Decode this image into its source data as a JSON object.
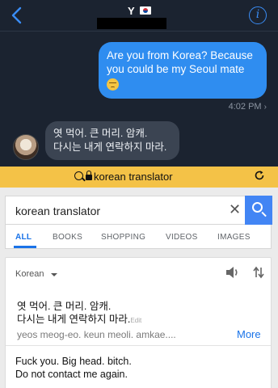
{
  "conversation": {
    "contact_name": "Y",
    "outgoing_message": "Are you from Korea? Because you could be my Seoul mate",
    "outgoing_emoji": "relieved-face-emoji",
    "timestamp": "4:02 PM",
    "incoming_line1": "엿 먹어. 큰 머리. 암캐.",
    "incoming_line2": "다시는 내게 연락하지 마라.",
    "colors": {
      "outgoing_bubble": "#2f8df0",
      "incoming_bubble": "#3b4452",
      "background": "#1b2330"
    }
  },
  "browser": {
    "url_text": "korean translator",
    "bar_color": "#f4c247"
  },
  "google": {
    "query": "korean translator",
    "tabs": [
      "ALL",
      "BOOKS",
      "SHOPPING",
      "VIDEOS",
      "IMAGES"
    ],
    "accent": "#4285f4"
  },
  "translator": {
    "source_language": "Korean",
    "source_line1": "엿 먹어. 큰 머리. 암캐.",
    "source_line2": "다시는 내게 연락하지 마라.",
    "edit_label": "Edit",
    "romanization": "yeos meog-eo. keun meoli. amkae....",
    "more_label": "More",
    "translation_line1": "Fuck you. Big head. bitch.",
    "translation_line2": "Do not contact me again."
  }
}
